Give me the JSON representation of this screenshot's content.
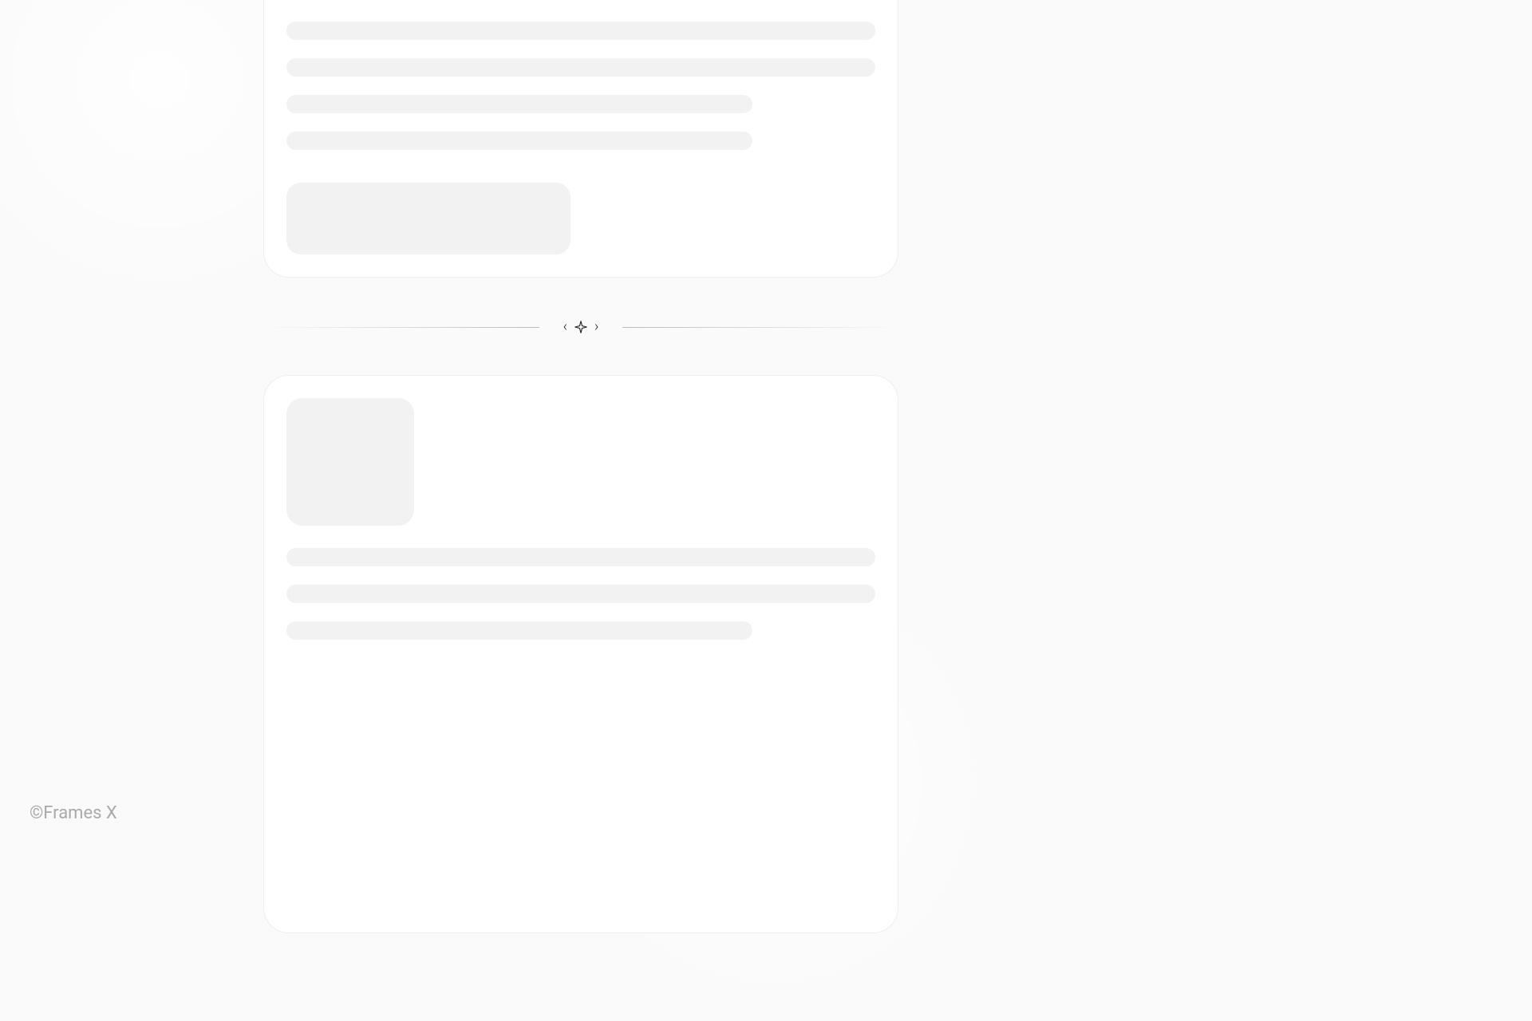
{
  "copyright": "©Frames X",
  "divider": {
    "left_chevron": "‹",
    "right_chevron": "›"
  },
  "skeleton": {
    "card_top": {
      "lines": [
        "full",
        "full",
        "partial",
        "partial"
      ],
      "has_button": true
    },
    "card_bottom": {
      "has_square": true,
      "lines": [
        "full",
        "full",
        "partial"
      ]
    }
  }
}
